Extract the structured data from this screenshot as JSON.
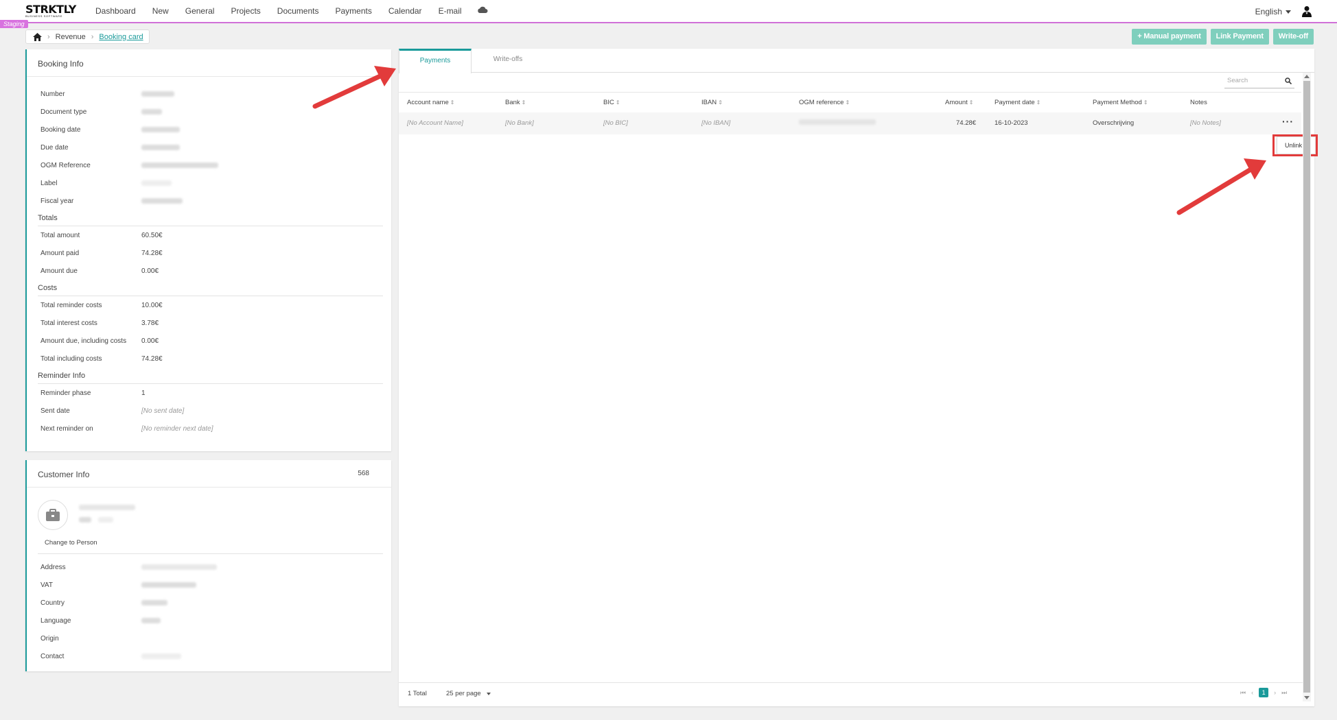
{
  "app": {
    "logo": "STRKTLY",
    "logo_sub": "BUSINESS SOFTWARE",
    "staging": "Staging",
    "nav": [
      "Dashboard",
      "New",
      "General",
      "Projects",
      "Documents",
      "Payments",
      "Calendar",
      "E-mail"
    ],
    "language": "English"
  },
  "breadcrumb": {
    "parent": "Revenue",
    "current": "Booking card"
  },
  "actions": {
    "manual_payment": "+ Manual payment",
    "link_payment": "Link Payment",
    "write_off": "Write-off"
  },
  "booking_info": {
    "title": "Booking Info",
    "fields": [
      {
        "label": "Number"
      },
      {
        "label": "Document type"
      },
      {
        "label": "Booking date"
      },
      {
        "label": "Due date"
      },
      {
        "label": "OGM Reference"
      },
      {
        "label": "Label"
      },
      {
        "label": "Fiscal year"
      }
    ],
    "totals_title": "Totals",
    "totals": [
      {
        "label": "Total amount",
        "value": "60.50€"
      },
      {
        "label": "Amount paid",
        "value": "74.28€"
      },
      {
        "label": "Amount due",
        "value": "0.00€"
      }
    ],
    "costs_title": "Costs",
    "costs": [
      {
        "label": "Total reminder costs",
        "value": "10.00€"
      },
      {
        "label": "Total interest costs",
        "value": "3.78€"
      },
      {
        "label": "Amount due, including costs",
        "value": "0.00€"
      },
      {
        "label": "Total including costs",
        "value": "74.28€"
      }
    ],
    "reminder_title": "Reminder Info",
    "reminder": [
      {
        "label": "Reminder phase",
        "value": "1"
      },
      {
        "label": "Sent date",
        "value": "[No sent date]"
      },
      {
        "label": "Next reminder on",
        "value": "[No reminder next date]"
      }
    ]
  },
  "customer_info": {
    "title": "Customer Info",
    "count": "568",
    "change_to_person": "Change to Person",
    "fields": [
      {
        "label": "Address"
      },
      {
        "label": "VAT"
      },
      {
        "label": "Country"
      },
      {
        "label": "Language"
      },
      {
        "label": "Origin"
      },
      {
        "label": "Contact"
      }
    ]
  },
  "payments": {
    "tabs": [
      "Payments",
      "Write-offs"
    ],
    "search_placeholder": "Search",
    "columns": [
      "Account name",
      "Bank",
      "BIC",
      "IBAN",
      "OGM reference",
      "Amount",
      "Payment date",
      "Payment Method",
      "Notes"
    ],
    "row": {
      "account_name": "[No Account Name]",
      "bank": "[No Bank]",
      "bic": "[No BIC]",
      "iban": "[No IBAN]",
      "amount": "74.28€",
      "payment_date": "16-10-2023",
      "payment_method": "Overschrijving",
      "notes": "[No Notes]"
    },
    "menu_item": "Unlink",
    "total": "1 Total",
    "per_page": "25 per page",
    "page": "1"
  },
  "colors": {
    "accent": "#1a9a9a",
    "staging": "#d873df",
    "button": "#7fcfbd",
    "annotation": "#e23b3b"
  },
  "icons": [
    "cloud-icon",
    "user-icon",
    "home-icon",
    "search-icon",
    "briefcase-icon",
    "more-icon"
  ]
}
